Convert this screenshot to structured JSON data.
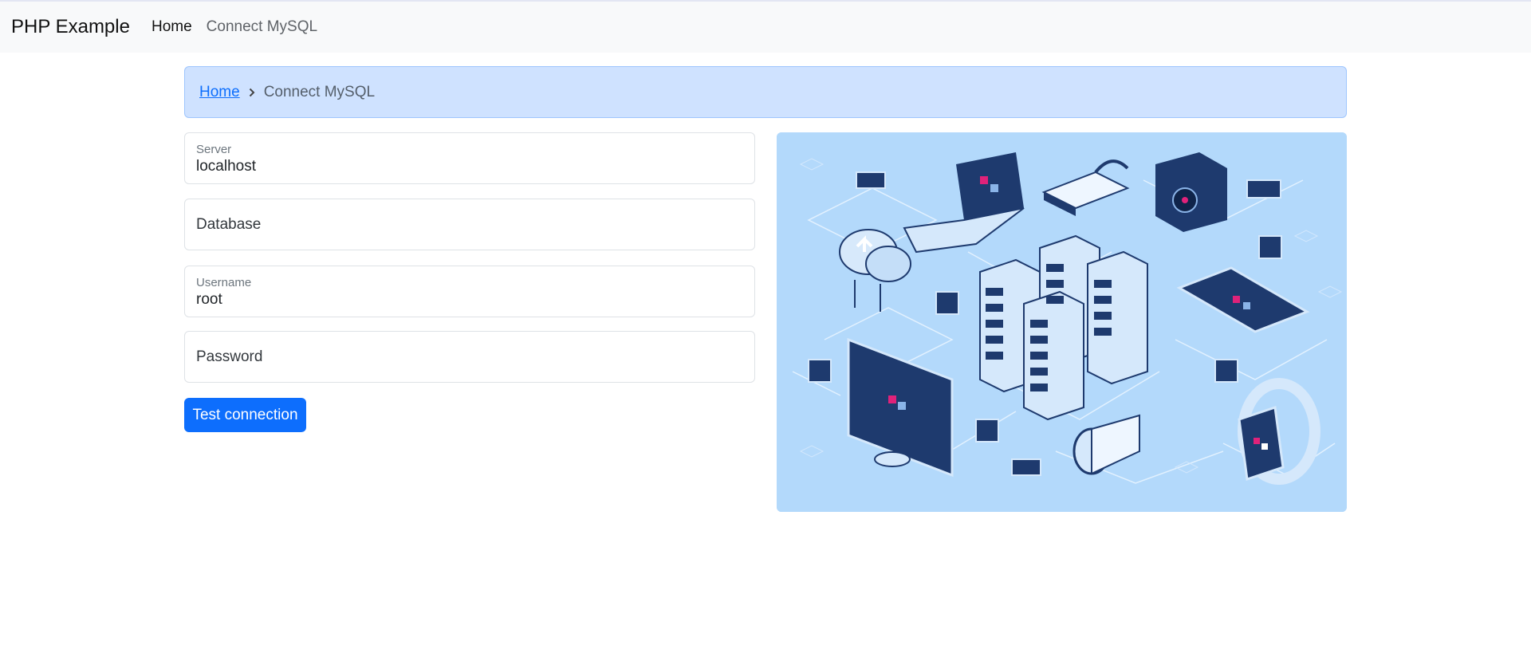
{
  "navbar": {
    "brand": "PHP Example",
    "links": [
      {
        "label": "Home",
        "active": true
      },
      {
        "label": "Connect MySQL",
        "active": false
      }
    ]
  },
  "breadcrumb": {
    "home": "Home",
    "current": "Connect MySQL"
  },
  "form": {
    "server": {
      "label": "Server",
      "value": "localhost"
    },
    "database": {
      "placeholder": "Database",
      "value": ""
    },
    "username": {
      "label": "Username",
      "value": "root"
    },
    "password": {
      "placeholder": "Password",
      "value": ""
    },
    "submit_label": "Test connection"
  },
  "colors": {
    "primary": "#0d6efd",
    "breadcrumb_bg": "#cfe2ff",
    "illustration_bg": "#b3d9fb",
    "illustration_dark": "#1e3a6e",
    "illustration_accent": "#e0227a"
  }
}
